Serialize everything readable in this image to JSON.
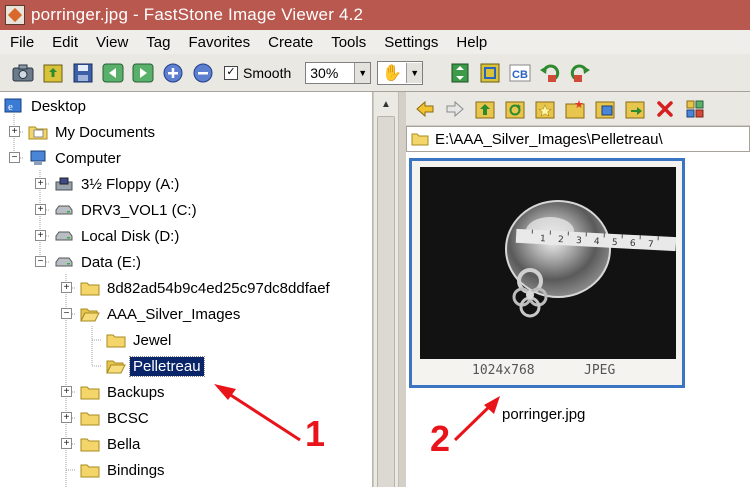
{
  "window": {
    "title": "porringer.jpg  -  FastStone Image Viewer 4.2"
  },
  "menu": [
    "File",
    "Edit",
    "View",
    "Tag",
    "Favorites",
    "Create",
    "Tools",
    "Settings",
    "Help"
  ],
  "toolbar": {
    "smooth_label": "Smooth",
    "smooth_checked": "✓",
    "zoom_value": "30%",
    "hand_glyph": "✋",
    "dropdown_arrow": "▼"
  },
  "tree": {
    "items": [
      {
        "label": "Desktop"
      },
      {
        "label": "My Documents"
      },
      {
        "label": "Computer"
      },
      {
        "label": "3½ Floppy (A:)"
      },
      {
        "label": "DRV3_VOL1 (C:)"
      },
      {
        "label": "Local Disk (D:)"
      },
      {
        "label": "Data (E:)"
      },
      {
        "label": "8d82ad54b9c4ed25c97dc8ddfaef"
      },
      {
        "label": "AAA_Silver_Images"
      },
      {
        "label": "Jewel"
      },
      {
        "label": "Pelletreau"
      },
      {
        "label": "Backups"
      },
      {
        "label": "BCSC"
      },
      {
        "label": "Bella"
      },
      {
        "label": "Bindings"
      }
    ],
    "plus": "+",
    "minus": "−"
  },
  "path": {
    "current": "E:\\AAA_Silver_Images\\Pelletreau\\"
  },
  "thumbnail": {
    "filename": "porringer.jpg",
    "dimensions": "1024x768",
    "filetype": "JPEG",
    "ruler_digits": "1 2 3 4 5 6 7"
  },
  "annotations": {
    "one": "1",
    "two": "2"
  },
  "colors": {
    "titlebar": "#b9584f",
    "selection": "#0a246a",
    "thumb_border": "#3a75c4",
    "annotation": "#e8141a"
  }
}
